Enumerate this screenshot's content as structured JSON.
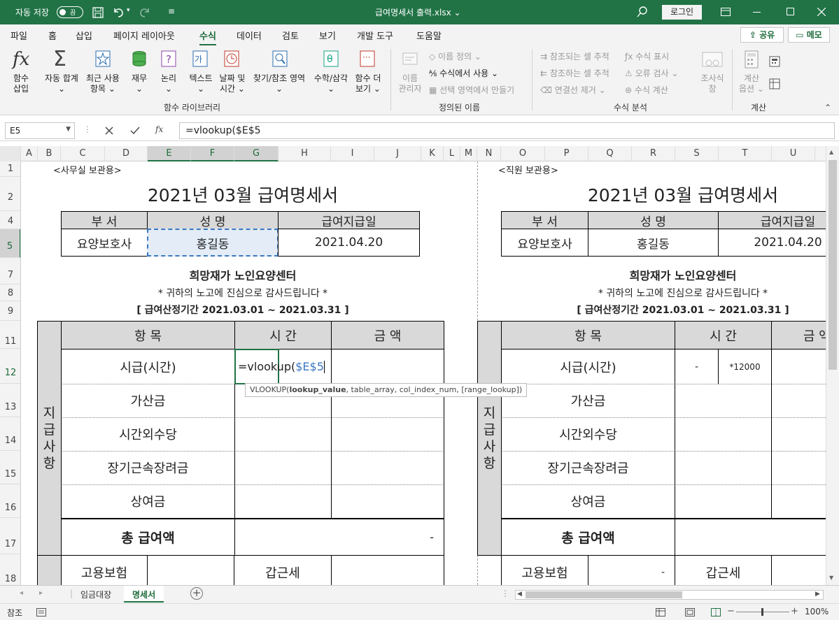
{
  "titlebar": {
    "autosave_label": "자동 저장",
    "autosave_state": "끔",
    "file_name": "급여명세서 출력.xlsx",
    "login": "로그인"
  },
  "menu": {
    "tabs": [
      "파일",
      "홈",
      "삽입",
      "페이지 레이아웃",
      "수식",
      "데이터",
      "검토",
      "보기",
      "개발 도구",
      "도움말"
    ],
    "active": "수식",
    "share": "공유",
    "memo": "메모"
  },
  "ribbon": {
    "insert_function": "함수\n삽입",
    "autosum": "자동 합계",
    "recent": "최근 사용\n항목",
    "finance": "재무",
    "logical": "논리",
    "text": "텍스트",
    "datetime": "날짜 및\n시간",
    "lookup": "찾기/참조 영역",
    "math": "수학/삼각",
    "more": "함수 더\n보기",
    "group_library": "함수 라이브러리",
    "name_manager": "이름\n관리자",
    "define_name": "이름 정의",
    "use_in_formula": "수식에서 사용",
    "create_from_selection": "선택 영역에서 만들기",
    "group_defined": "정의된 이름",
    "trace_precedents": "참조되는 셀 추적",
    "trace_dependents": "참조하는 셀 추적",
    "remove_arrows": "연결선 제거",
    "show_formulas": "수식 표시",
    "error_check": "오류 검사",
    "evaluate": "수식 계산",
    "watch": "조사식\n창",
    "group_audit": "수식 분석",
    "calc_options": "계산\n옵션",
    "group_calc": "계산"
  },
  "formula_bar": {
    "name_box": "E5",
    "formula": "=vlookup($E$5"
  },
  "columns": [
    "A",
    "B",
    "C",
    "D",
    "E",
    "F",
    "G",
    "H",
    "I",
    "J",
    "K",
    "L",
    "M",
    "N",
    "O",
    "P",
    "Q",
    "R",
    "S",
    "T",
    "U"
  ],
  "rows": [
    "1",
    "2",
    "4",
    "5",
    "7",
    "8",
    "9",
    "11",
    "12",
    "13",
    "14",
    "15",
    "16",
    "17",
    "18"
  ],
  "sheet": {
    "office_copy": "<사무실 보관용>",
    "staff_copy": "<직원 보관용>",
    "title": "2021년 03월 급여명세서",
    "dept_label": "부    서",
    "name_label": "성    명",
    "paydate_label": "급여지급일",
    "dept_value": "요양보호사",
    "name_value": "홍길동",
    "paydate_value": "2021.04.20",
    "center": "희망재가 노인요양센터",
    "thanks": "* 귀하의 노고에 진심으로 감사드립니다 *",
    "period": "[ 급여산정기간 2021.03.01 ~ 2021.03.31 ]",
    "item_label": "항  목",
    "time_label": "시  간",
    "amount_label": "금    액",
    "side_label": "지급사항",
    "items": [
      "시급(시간)",
      "가산금",
      "시간외수당",
      "장기근속장려금",
      "상여금"
    ],
    "total_label": "총 급여액",
    "total_value": "-",
    "insurance": "고용보험",
    "tax": "갑근세",
    "dash": "-",
    "editing_prefix": "=vlookup(",
    "editing_ref": "$E$5",
    "right_rate": "*12000"
  },
  "tooltip": {
    "fn": "VLOOKUP(",
    "arg1": "lookup_value",
    ",rest": ", table_array, col_index_num, [range_lookup])"
  },
  "tabs": [
    "임금대장",
    "명세서"
  ],
  "active_tab": "명세서",
  "status": {
    "mode": "참조",
    "zoom": "100%"
  }
}
